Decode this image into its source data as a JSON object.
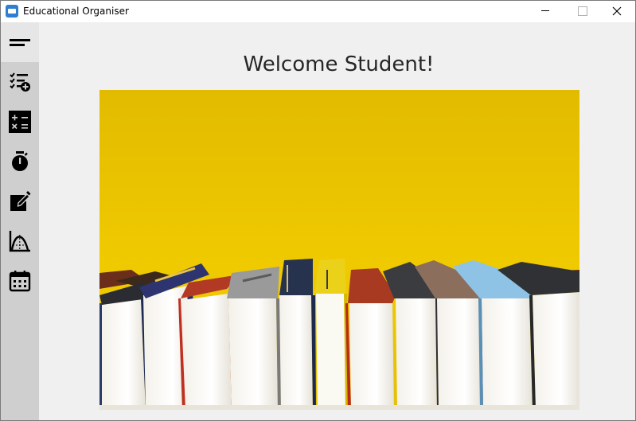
{
  "window": {
    "title": "Educational Organiser",
    "controls": [
      "minimize",
      "maximize",
      "close"
    ]
  },
  "sidebar": {
    "items": [
      {
        "id": "menu",
        "icon": "hamburger-menu-icon"
      },
      {
        "id": "tasks",
        "icon": "task-list-add-icon"
      },
      {
        "id": "calculator",
        "icon": "calculator-icon"
      },
      {
        "id": "timer",
        "icon": "stopwatch-icon"
      },
      {
        "id": "notes",
        "icon": "edit-note-icon"
      },
      {
        "id": "graph",
        "icon": "graph-curve-icon"
      },
      {
        "id": "calendar",
        "icon": "calendar-icon"
      }
    ]
  },
  "main": {
    "heading": "Welcome Student!",
    "hero_image": "row of books against a yellow wall"
  },
  "colors": {
    "sidebar_bg": "#cfcfcf",
    "active_item_bg": "#e6e6e6",
    "content_bg": "#f0f0f0",
    "hero_yellow": "#e9c400"
  }
}
